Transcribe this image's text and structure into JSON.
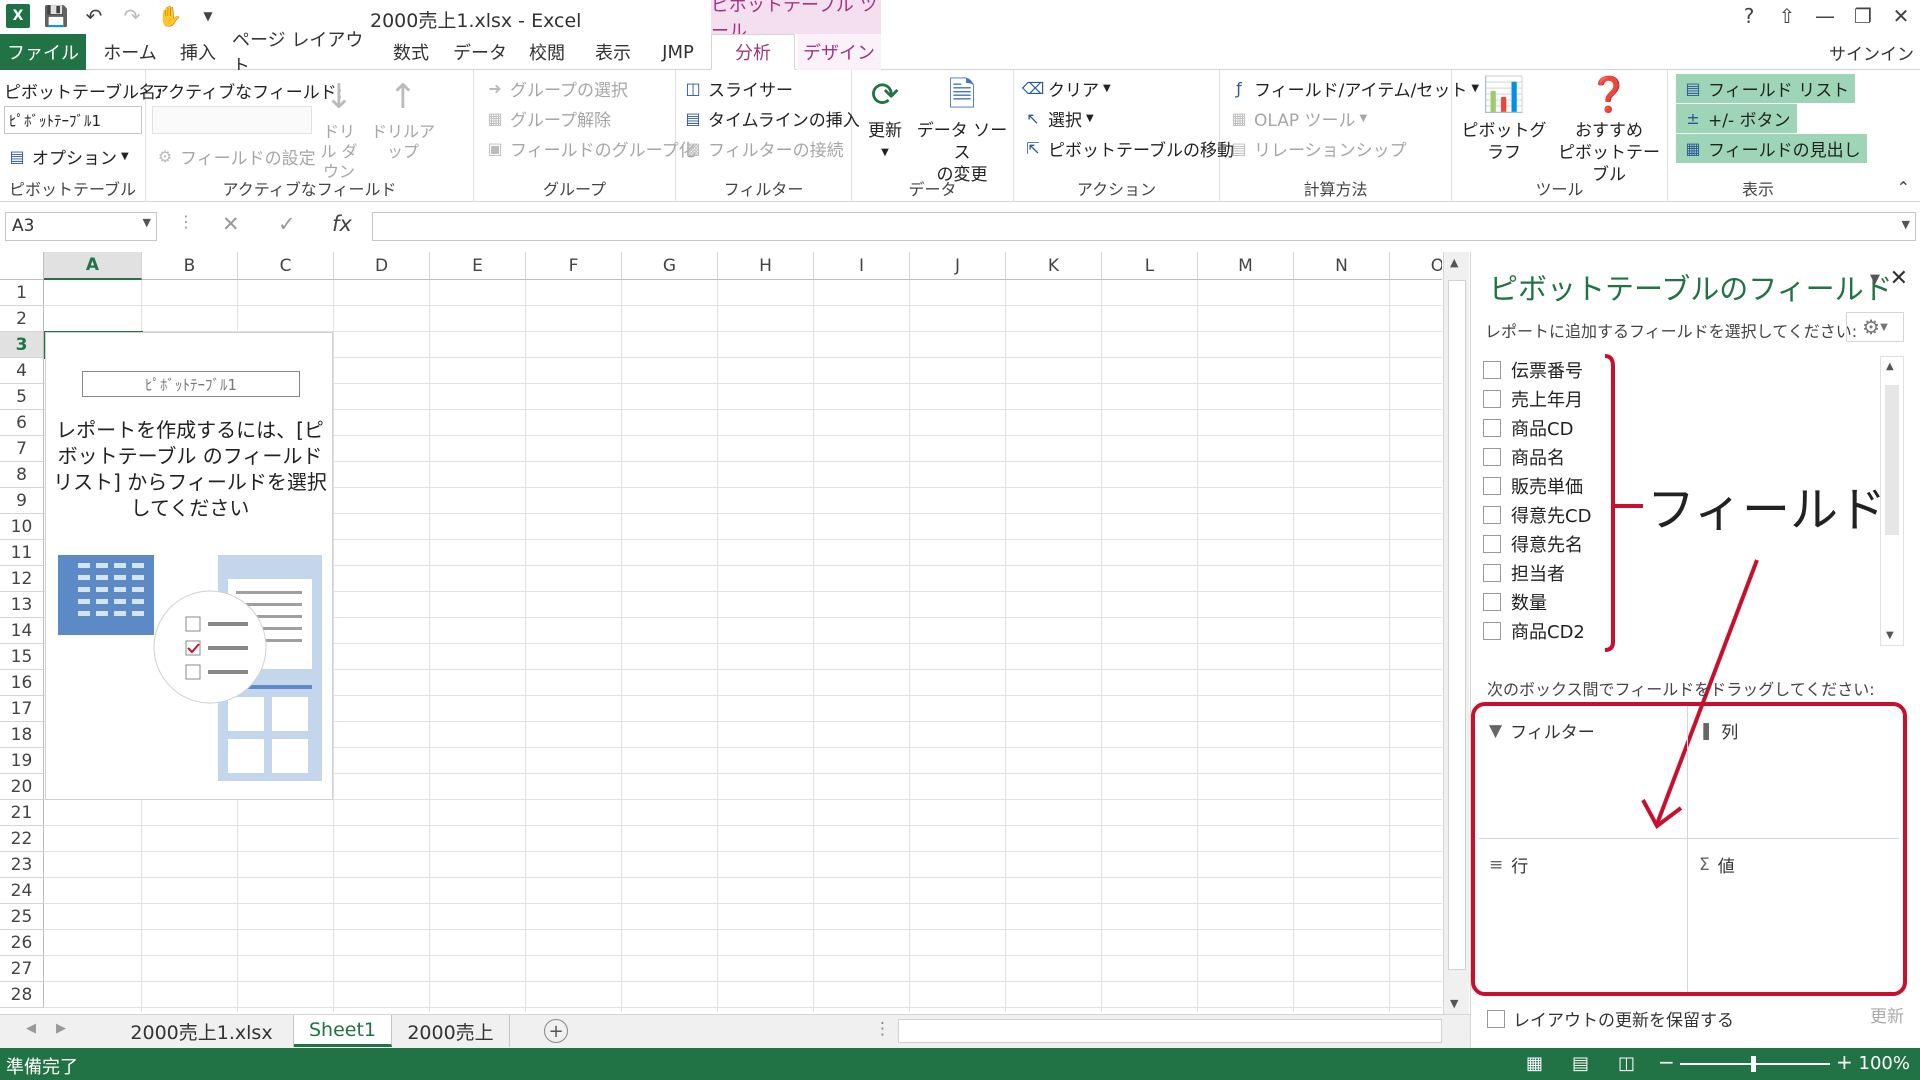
{
  "title_bar": {
    "doc_title": "2000売上1.xlsx - Excel",
    "contextual_tools": "ピボットテーブル ツール",
    "help": "?",
    "sign_in": "サインイン"
  },
  "tabs": {
    "file": "ファイル",
    "home": "ホーム",
    "insert": "挿入",
    "page_layout": "ページ レイアウト",
    "formulas": "数式",
    "data": "データ",
    "review": "校閲",
    "view": "表示",
    "jmp": "JMP",
    "analyze": "分析",
    "design": "デザイン"
  },
  "ribbon": {
    "pivottable": {
      "name_label": "ピボットテーブル名:",
      "name_value": "ﾋﾟﾎﾞｯﾄﾃｰﾌﾞﾙ1",
      "options": "オプション",
      "group": "ピボットテーブル"
    },
    "active_field": {
      "label": "アクティブなフィールド:",
      "field_settings": "フィールドの設定",
      "drill_down": "ドリル ダウン",
      "drill_up": "ドリルアップ",
      "group": "アクティブなフィールド"
    },
    "group_grp": {
      "group_selection": "グループの選択",
      "ungroup": "グループ解除",
      "group_field": "フィールドのグループ化",
      "group": "グループ"
    },
    "filter": {
      "slicer": "スライサー",
      "timeline": "タイムラインの挿入",
      "filter_connections": "フィルターの接続",
      "group": "フィルター"
    },
    "data": {
      "refresh": "更新",
      "change_source_1": "データ ソース",
      "change_source_2": "の変更",
      "group": "データ"
    },
    "actions": {
      "clear": "クリア",
      "select": "選択",
      "move": "ピボットテーブルの移動",
      "group": "アクション"
    },
    "calculations": {
      "fields_items": "フィールド/アイテム/セット",
      "olap": "OLAP ツール",
      "relationships": "リレーションシップ",
      "group": "計算方法"
    },
    "tools": {
      "pivotchart": "ピボットグラフ",
      "recommended_1": "おすすめ",
      "recommended_2": "ピボットテーブル",
      "group": "ツール"
    },
    "show": {
      "field_list": "フィールド リスト",
      "buttons": "+/- ボタン",
      "headers": "フィールドの見出し",
      "group": "表示"
    }
  },
  "formula_bar": {
    "name_box": "A3",
    "fx": "fx"
  },
  "grid": {
    "columns": [
      "A",
      "B",
      "C",
      "D",
      "E",
      "F",
      "G",
      "H",
      "I",
      "J",
      "K",
      "L",
      "M",
      "N",
      "O"
    ],
    "rows": [
      "1",
      "2",
      "3",
      "4",
      "5",
      "6",
      "7",
      "8",
      "9",
      "10",
      "11",
      "12",
      "13",
      "14",
      "15",
      "16",
      "17",
      "18",
      "19",
      "20",
      "21",
      "22",
      "23",
      "24",
      "25",
      "26",
      "27",
      "28"
    ],
    "placeholder_name": "ﾋﾟﾎﾞｯﾄﾃｰﾌﾞﾙ1",
    "placeholder_text": "レポートを作成するには、[ピボットテーブル のフィールド リスト] からフィールドを選択してください"
  },
  "sheets": [
    "2000売上1.xlsx",
    "Sheet1",
    "2000売上"
  ],
  "pane": {
    "title": "ピボットテーブルのフィールド",
    "subtitle": "レポートに追加するフィールドを選択してください:",
    "fields": [
      "伝票番号",
      "売上年月",
      "商品CD",
      "商品名",
      "販売単価",
      "得意先CD",
      "得意先名",
      "担当者",
      "数量",
      "商品CD2"
    ],
    "drag_hint": "次のボックス間でフィールドをドラッグしてください:",
    "areas": {
      "filters": "フィルター",
      "columns": "列",
      "rows": "行",
      "values": "値"
    },
    "annotation": "フィールド",
    "defer": "レイアウトの更新を保留する",
    "update": "更新"
  },
  "status": {
    "ready": "準備完了",
    "zoom": "100%"
  },
  "colors": {
    "excel_green": "#217346",
    "pivot_accent": "#a4347f",
    "annotation_red": "#c8102e"
  }
}
